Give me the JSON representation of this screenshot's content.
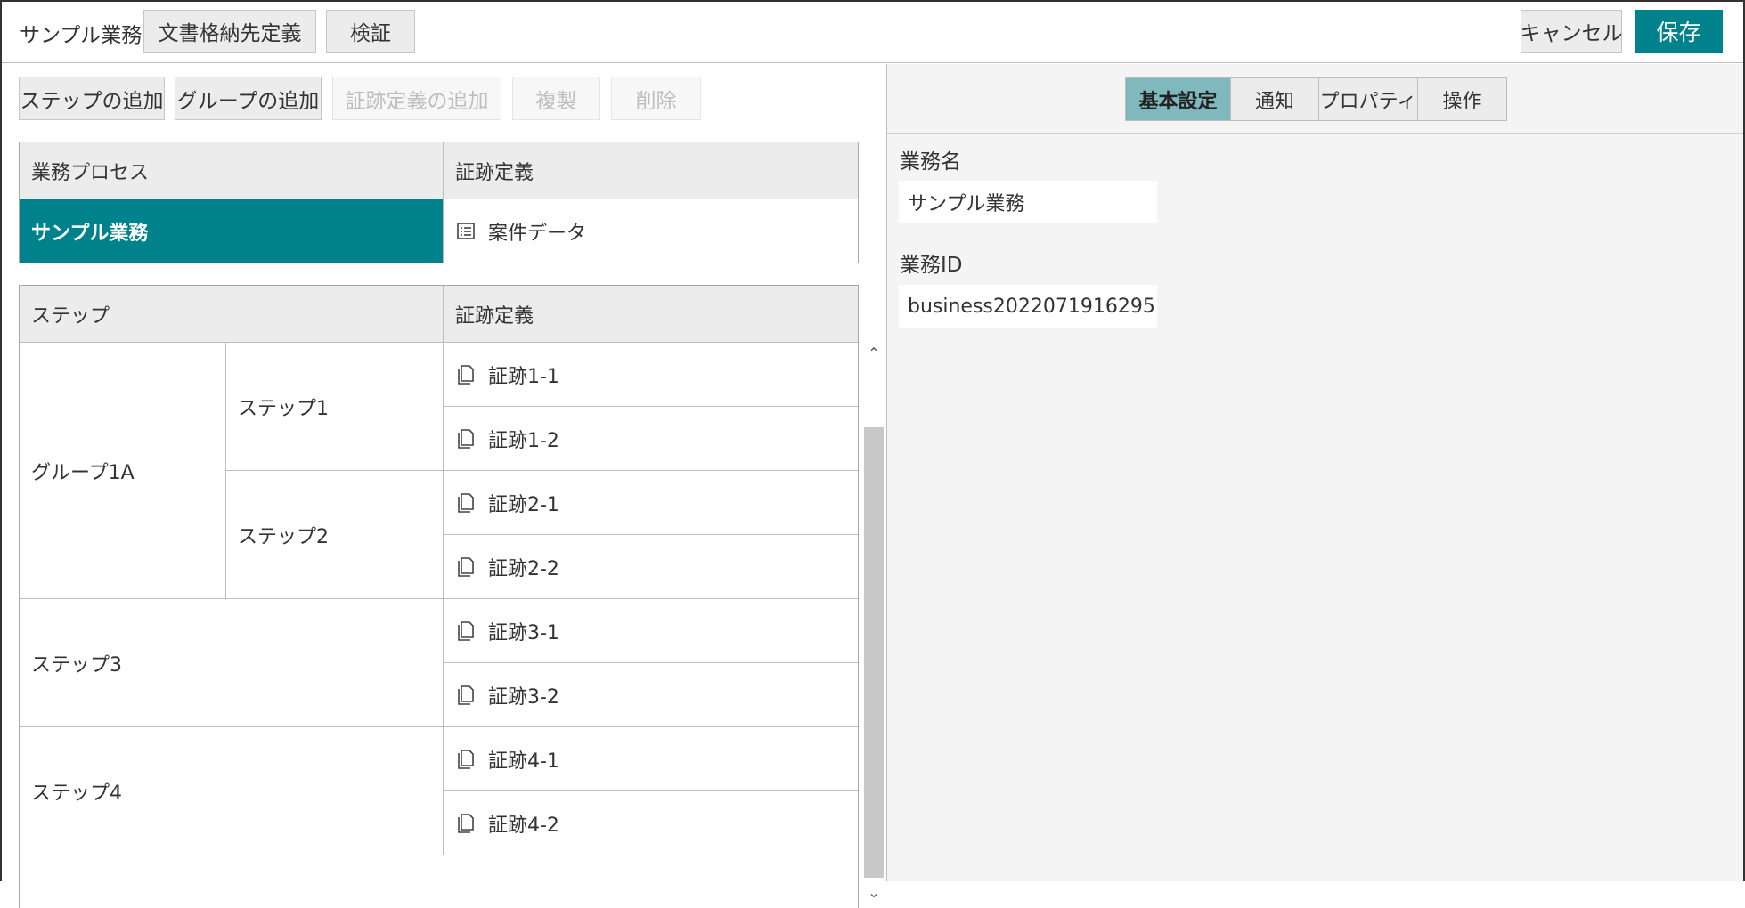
{
  "header": {
    "app_title": "サンプル業務",
    "doc_store_button": "文書格納先定義",
    "verify_button": "検証",
    "cancel_button": "キャンセル",
    "save_button": "保存"
  },
  "toolbar": {
    "add_step": "ステップの追加",
    "add_group": "グループの追加",
    "add_evidence": "証跡定義の追加",
    "duplicate": "複製",
    "delete": "削除"
  },
  "process_table": {
    "col_process": "業務プロセス",
    "col_evidence": "証跡定義",
    "process_name": "サンプル業務",
    "evidence_name": "案件データ"
  },
  "step_table": {
    "col_step": "ステップ",
    "col_evidence": "証跡定義",
    "group1": "グループ1A",
    "step1": "ステップ1",
    "step2": "ステップ2",
    "step3": "ステップ3",
    "step4": "ステップ4",
    "evidences": [
      "証跡1-1",
      "証跡1-2",
      "証跡2-1",
      "証跡2-2",
      "証跡3-1",
      "証跡3-2",
      "証跡4-1",
      "証跡4-2"
    ]
  },
  "tabs": [
    "基本設定",
    "通知",
    "プロパティ",
    "操作"
  ],
  "form": {
    "name_label": "業務名",
    "name_value": "サンプル業務",
    "id_label": "業務ID",
    "id_value": "business2022071916295"
  },
  "colors": {
    "accent": "#00828c",
    "tab_active": "#7fb8bd"
  }
}
